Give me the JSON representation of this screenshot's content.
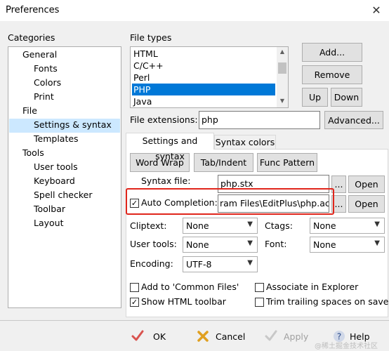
{
  "window": {
    "title": "Preferences",
    "close": "✕"
  },
  "categories": {
    "label": "Categories",
    "items": [
      {
        "label": "General",
        "level": 1
      },
      {
        "label": "Fonts",
        "level": 2
      },
      {
        "label": "Colors",
        "level": 2
      },
      {
        "label": "Print",
        "level": 2
      },
      {
        "label": "File",
        "level": 1
      },
      {
        "label": "Settings & syntax",
        "level": 2,
        "selected": true
      },
      {
        "label": "Templates",
        "level": 2
      },
      {
        "label": "Tools",
        "level": 1
      },
      {
        "label": "User tools",
        "level": 2
      },
      {
        "label": "Keyboard",
        "level": 2
      },
      {
        "label": "Spell checker",
        "level": 2
      },
      {
        "label": "Toolbar",
        "level": 2
      },
      {
        "label": "Layout",
        "level": 2
      }
    ]
  },
  "file_types": {
    "label": "File types",
    "items": [
      "HTML",
      "C/C++",
      "Perl",
      "PHP",
      "Java"
    ],
    "selected": "PHP",
    "buttons": {
      "add": "Add...",
      "remove": "Remove",
      "up": "Up",
      "down": "Down"
    }
  },
  "file_extensions": {
    "label": "File extensions:",
    "value": "php",
    "advanced": "Advanced..."
  },
  "tabs": [
    "Settings and syntax",
    "Syntax colors"
  ],
  "settings": {
    "word_wrap": "Word Wrap",
    "tab_indent": "Tab/Indent",
    "func_pattern": "Func Pattern",
    "syntax_file_label": "Syntax file:",
    "syntax_file_value": "php.stx",
    "auto_completion_label": "Auto Completion:",
    "auto_completion_checked": true,
    "auto_completion_value": "ram Files\\EditPlus\\php.acp",
    "browse": "...",
    "open": "Open",
    "cliptext_label": "Cliptext:",
    "cliptext_value": "None",
    "ctags_label": "Ctags:",
    "ctags_value": "None",
    "usertools_label": "User tools:",
    "usertools_value": "None",
    "font_label": "Font:",
    "font_value": "None",
    "encoding_label": "Encoding:",
    "encoding_value": "UTF-8",
    "add_common": "Add to 'Common Files'",
    "add_common_checked": false,
    "show_html_toolbar": "Show HTML toolbar",
    "show_html_toolbar_checked": true,
    "associate_explorer": "Associate in Explorer",
    "associate_explorer_checked": false,
    "trim_trailing": "Trim trailing spaces on save",
    "trim_trailing_checked": false
  },
  "footer": {
    "ok": "OK",
    "cancel": "Cancel",
    "apply": "Apply",
    "help": "Help"
  },
  "watermark": "@稀土掘金技术社区",
  "colors": {
    "highlight_red": "#e0251b",
    "selection_blue": "#0078d7",
    "tree_select": "#cce8ff"
  }
}
